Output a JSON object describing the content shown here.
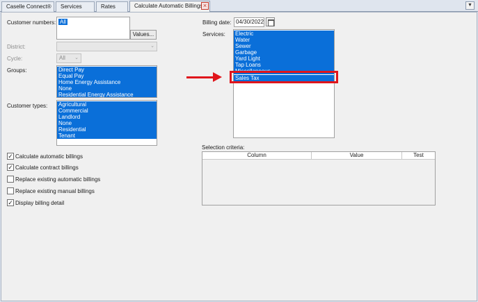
{
  "tabs": [
    {
      "label": "Caselle Connect®"
    },
    {
      "label": "Services"
    },
    {
      "label": "Rates"
    },
    {
      "label": "Calculate Automatic Billings"
    }
  ],
  "customer_numbers": {
    "label": "Customer numbers:",
    "value": "All",
    "button": "Values..."
  },
  "district": {
    "label": "District:",
    "value": ""
  },
  "cycle": {
    "label": "Cycle:",
    "value": "All"
  },
  "groups": {
    "label": "Groups:",
    "items": [
      "Direct Pay",
      "Equal Pay",
      "Home Energy Assistance",
      "None",
      "Residential Energy Assistance"
    ]
  },
  "customer_types": {
    "label": "Customer types:",
    "items": [
      "Agricultural",
      "Commercial",
      "Landlord",
      "None",
      "Residential",
      "Tenant"
    ]
  },
  "options": [
    {
      "label": "Calculate automatic billings",
      "checked": true
    },
    {
      "label": "Calculate contract billings",
      "checked": true
    },
    {
      "label": "Replace existing automatic billings",
      "checked": false
    },
    {
      "label": "Replace existing manual billings",
      "checked": false
    },
    {
      "label": "Display billing detail",
      "checked": true
    }
  ],
  "billing_date": {
    "label": "Billing date:",
    "value": "04/30/2022"
  },
  "services": {
    "label": "Services:",
    "items": [
      "Electric",
      "Water",
      "Sewer",
      "Garbage",
      "Yard Light",
      "Tap Loans",
      "Miscellaneous",
      "Sales Tax"
    ]
  },
  "selection_criteria": {
    "label": "Selection criteria:",
    "columns": [
      "Column",
      "Value",
      "Test"
    ]
  },
  "colors": {
    "selection": "#0a6fd9",
    "annotation": "#e0151b"
  }
}
